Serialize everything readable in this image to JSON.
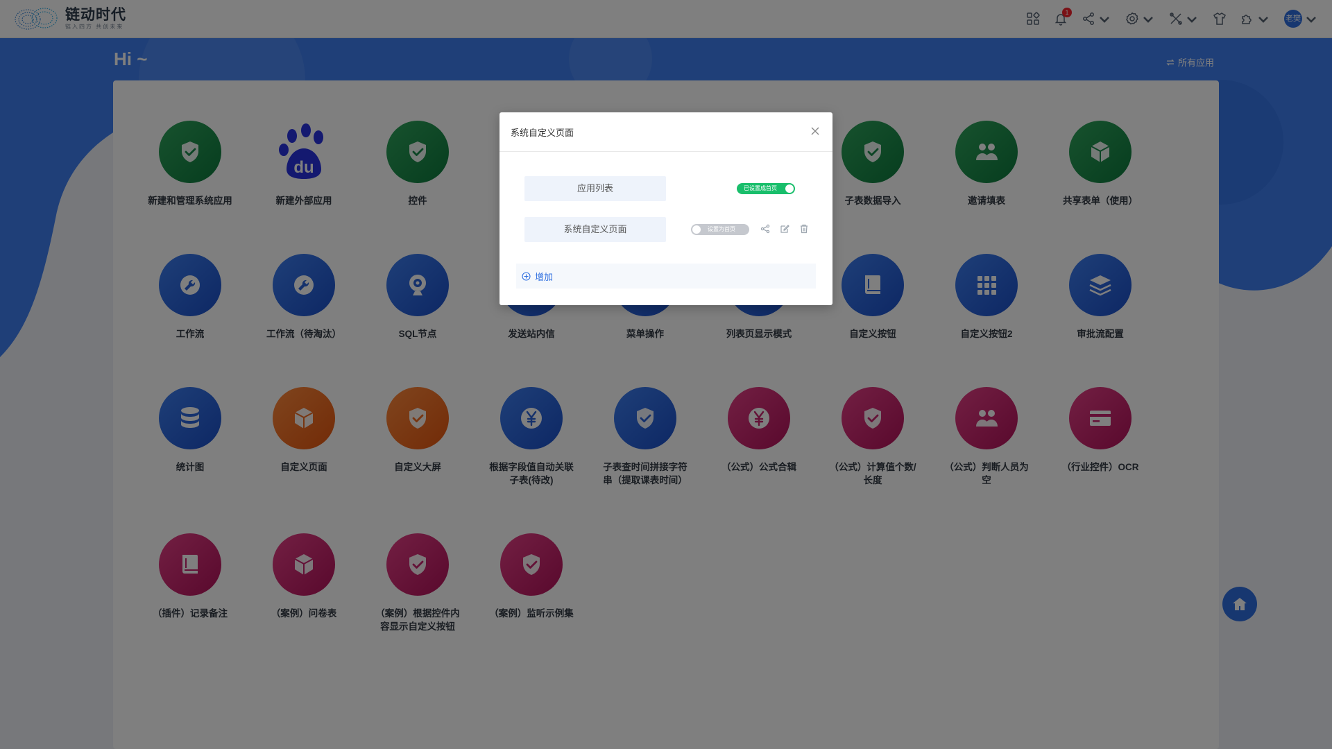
{
  "header": {
    "logo_title": "链动时代",
    "logo_slogan": "链入四方 共创未来",
    "notification_count": "1",
    "user_name": "老樊"
  },
  "greeting": "Hi ~",
  "all_apps_link": "所有应用",
  "apps": [
    {
      "label": "新建和管理系统应用",
      "color": "green",
      "icon": "shield-check-icon"
    },
    {
      "label": "新建外部应用",
      "color": "baidu",
      "icon": "baidu-paw-icon"
    },
    {
      "label": "控件",
      "color": "green",
      "icon": "shield-check-icon"
    },
    {
      "label": "",
      "color": "green",
      "icon": "shield-check-icon"
    },
    {
      "label": "",
      "color": "green",
      "icon": "shield-check-icon"
    },
    {
      "label": "",
      "color": "green",
      "icon": "shield-check-icon"
    },
    {
      "label": "子表数据导入",
      "color": "green",
      "icon": "shield-check-icon"
    },
    {
      "label": "邀请填表",
      "color": "green",
      "icon": "people-icon"
    },
    {
      "label": "共享表单（使用）",
      "color": "green",
      "icon": "cube-icon"
    },
    {
      "label": "工作流",
      "color": "blue",
      "icon": "wrench-icon"
    },
    {
      "label": "工作流（待淘汰）",
      "color": "blue",
      "icon": "wrench-icon"
    },
    {
      "label": "SQL节点",
      "color": "blue",
      "icon": "webcam-icon"
    },
    {
      "label": "发送站内信",
      "color": "blue",
      "icon": "shield-check-icon"
    },
    {
      "label": "菜单操作",
      "color": "blue",
      "icon": "shield-check-icon"
    },
    {
      "label": "列表页显示模式",
      "color": "blue",
      "icon": "shield-check-icon"
    },
    {
      "label": "自定义按钮",
      "color": "blue",
      "icon": "book-icon"
    },
    {
      "label": "自定义按钮2",
      "color": "blue",
      "icon": "grid-icon"
    },
    {
      "label": "审批流配置",
      "color": "blue",
      "icon": "layers-icon"
    },
    {
      "label": "统计图",
      "color": "blue",
      "icon": "database-icon"
    },
    {
      "label": "自定义页面",
      "color": "orange",
      "icon": "cube-icon"
    },
    {
      "label": "自定义大屏",
      "color": "orange",
      "icon": "shield-check-icon"
    },
    {
      "label": "根据字段值自动关联子表(待改)",
      "color": "blue",
      "icon": "yen-icon"
    },
    {
      "label": "子表查时间拼接字符串（提取课表时间）",
      "color": "blue",
      "icon": "shield-check-icon"
    },
    {
      "label": "（公式）公式合辑",
      "color": "pink",
      "icon": "yen-icon"
    },
    {
      "label": "（公式）计算值个数/长度",
      "color": "pink",
      "icon": "shield-check-icon"
    },
    {
      "label": "（公式）判断人员为空",
      "color": "pink",
      "icon": "people-icon"
    },
    {
      "label": "（行业控件）OCR",
      "color": "pink",
      "icon": "card-icon"
    },
    {
      "label": "（插件）记录备注",
      "color": "pink",
      "icon": "book-icon"
    },
    {
      "label": "（案例）问卷表",
      "color": "pink",
      "icon": "cube-icon"
    },
    {
      "label": "（案例）根据控件内容显示自定义按钮",
      "color": "pink",
      "icon": "shield-check-icon"
    },
    {
      "label": "（案例）监听示例集",
      "color": "pink",
      "icon": "shield-check-icon"
    }
  ],
  "modal": {
    "title": "系统自定义页面",
    "rows": [
      {
        "name": "应用列表",
        "switch_label": "已设置成首页",
        "is_home": true
      },
      {
        "name": "系统自定义页面",
        "switch_label": "设置为首页",
        "is_home": false
      }
    ],
    "add_label": "增加"
  }
}
